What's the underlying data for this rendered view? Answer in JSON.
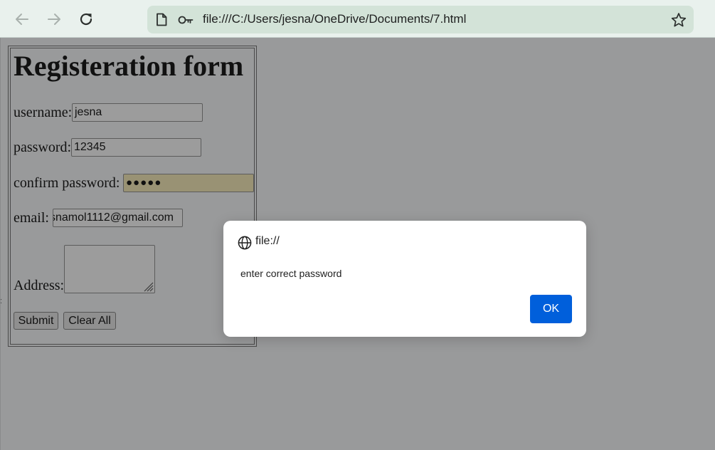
{
  "browser": {
    "url": "file:///C:/Users/jesna/OneDrive/Documents/7.html",
    "icons": {
      "back": "back-arrow-icon",
      "forward": "forward-arrow-icon",
      "reload": "reload-icon",
      "page": "page-icon",
      "site_info": "key-icon",
      "bookmark": "star-icon"
    }
  },
  "form": {
    "title": "Registeration form",
    "username_label": "username:",
    "username_value": "jesna",
    "password_label": "password:",
    "password_value": "12345",
    "confirm_label": "confirm password:",
    "confirm_value": "●●●●●",
    "email_label": "email:",
    "email_value": "snamol1112@gmail.com",
    "address_label": "Address:",
    "address_value": "",
    "submit_label": "Submit",
    "clear_label": "Clear All"
  },
  "dialog": {
    "origin": "file://",
    "message": "enter correct password",
    "ok_label": "OK",
    "icon": "globe-icon"
  },
  "colors": {
    "chrome_toolbar": "#e9f1ed",
    "omnibox": "#d3e3d8",
    "dimmed_page": "#999a9b",
    "autofill_field": "#999274",
    "ok_button": "#005fdb"
  }
}
